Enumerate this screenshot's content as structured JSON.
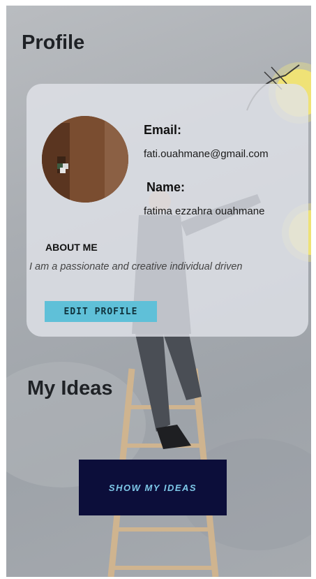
{
  "profile": {
    "title": "Profile",
    "email_label": "Email:",
    "email_value": "fati.ouahmane@gmail.com",
    "name_label": "Name:",
    "name_value": "fatima ezzahra ouahmane",
    "about_label": "ABOUT ME",
    "about_text": "I am a passionate and creative individual driven",
    "edit_button": "EDIT PROFILE"
  },
  "ideas": {
    "title": "My Ideas",
    "show_button": "SHOW MY IDEAS"
  },
  "colors": {
    "edit_button": "#5fc0d8",
    "show_button": "#0c0e3a",
    "show_button_text": "#7ec8e8",
    "card": "#e1e4ea"
  },
  "icons": [
    "avatar-photo",
    "lightbulb-illustration",
    "ladder-illustration"
  ]
}
